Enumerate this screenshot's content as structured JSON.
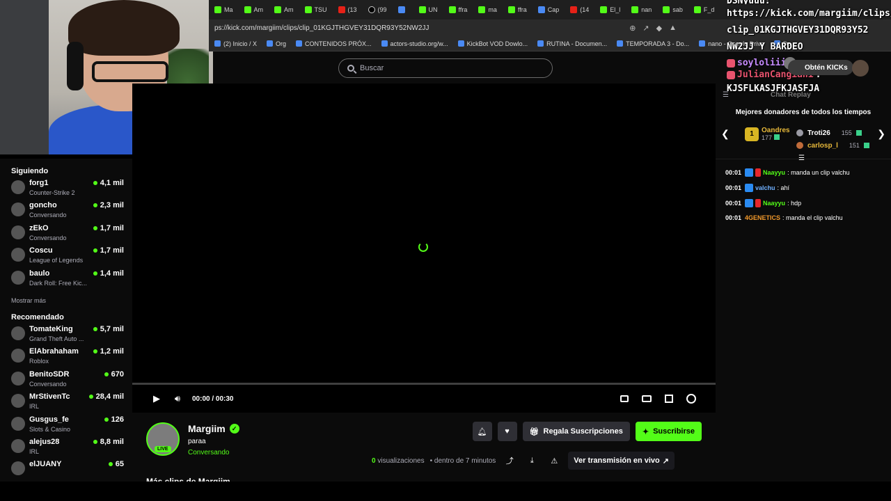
{
  "tabs": [
    "Ma",
    "Am",
    "Am",
    "TSU",
    "(13",
    "(99",
    "",
    "UN",
    "ffra",
    "ma",
    "ffra",
    "Cap",
    "(14",
    "El_l",
    "nan",
    "sab",
    "F_d"
  ],
  "url": "ps://kick.com/margiim/clips/clip_01KGJTHGVEY31DQR93Y52NW2JJ",
  "bookmarks": [
    "(2) Inicio / X",
    "Org",
    "CONTENIDOS PRÓX...",
    "actors-studio.org/w...",
    "KickBot VOD Dowlo...",
    "RUTINA - Documen...",
    "TEMPORADA 3 - Do...",
    "nano - Google Drive",
    "Do"
  ],
  "search": {
    "placeholder": "Buscar"
  },
  "sidebar": {
    "following_title": "Siguiendo",
    "following": [
      {
        "name": "forg1",
        "category": "Counter-Strike 2",
        "viewers": "4,1 mil"
      },
      {
        "name": "goncho",
        "category": "Conversando",
        "viewers": "2,3 mil"
      },
      {
        "name": "zEkO",
        "category": "Conversando",
        "viewers": "1,7 mil"
      },
      {
        "name": "Coscu",
        "category": "League of Legends",
        "viewers": "1,7 mil"
      },
      {
        "name": "baulo",
        "category": "Dark Roll: Free Kic...",
        "viewers": "1,4 mil"
      }
    ],
    "show_more": "Mostrar más",
    "recommended_title": "Recomendado",
    "recommended": [
      {
        "name": "TomateKing",
        "category": "Grand Theft Auto ...",
        "viewers": "5,7 mil"
      },
      {
        "name": "ElAbrahaham",
        "category": "Roblox",
        "viewers": "1,2 mil"
      },
      {
        "name": "BenitoSDR",
        "category": "Conversando",
        "viewers": "670"
      },
      {
        "name": "MrStivenTc",
        "category": "IRL",
        "viewers": "28,4 mil"
      },
      {
        "name": "Gusgus_fe",
        "category": "Slots & Casino",
        "viewers": "126"
      },
      {
        "name": "alejus28",
        "category": "IRL",
        "viewers": "8,8 mil"
      },
      {
        "name": "elJUANY",
        "category": "",
        "viewers": "65"
      }
    ]
  },
  "player": {
    "time": "00:00 / 00:30",
    "progress": 0
  },
  "channel": {
    "name": "Margiim",
    "title": "paraa",
    "category": "Conversando",
    "live_label": "LIVE",
    "gift_label": "Regala Suscripciones",
    "subscribe_label": "Suscribirse",
    "views_count": "0",
    "views_label": "visualizaciones",
    "time_ago": "• dentro de 7 minutos",
    "watch_live_label": "Ver transmisión en vivo",
    "clips_heading": "Más clips de Margiim"
  },
  "chat": {
    "header": "Chat Replay",
    "donors_title": "Mejores donadores de todos los tiempos",
    "donors": [
      {
        "name": "Oandres",
        "amount": "177"
      },
      {
        "name": "Troti26",
        "amount": "155"
      },
      {
        "name": "carlosp_l",
        "amount": "151"
      }
    ],
    "messages": [
      {
        "time": "00:01",
        "user": "Naayyu",
        "text": ": manda un clip valchu",
        "color": "green",
        "badges": 2
      },
      {
        "time": "00:01",
        "user": "valchu",
        "text": ": ahí",
        "color": "blue",
        "badges": 1
      },
      {
        "time": "00:01",
        "user": "Naayyu",
        "text": ": hdp",
        "color": "green",
        "badges": 2
      },
      {
        "time": "00:01",
        "user": "4GENETICS",
        "text": ": manda el clip valchu",
        "color": "orange",
        "badges": 0
      }
    ]
  },
  "overlay": {
    "top_partial": "DSNyuuu:",
    "lines": [
      "https://kick.com/margiim/clips/",
      "clip_01KGJTHGVEY31DQR93Y52",
      "NW2JJ Y BARDEO"
    ],
    "chats": [
      {
        "user": "soyloliii",
        "text": ":"
      },
      {
        "user": "JulianCangiani",
        "text": ":"
      }
    ],
    "last_line": "KJSFLKASJFKJASFJA",
    "kicks_label": "Obtén KICKs"
  },
  "colors": {
    "accent": "#53fc18",
    "background": "#0b0b0b"
  }
}
